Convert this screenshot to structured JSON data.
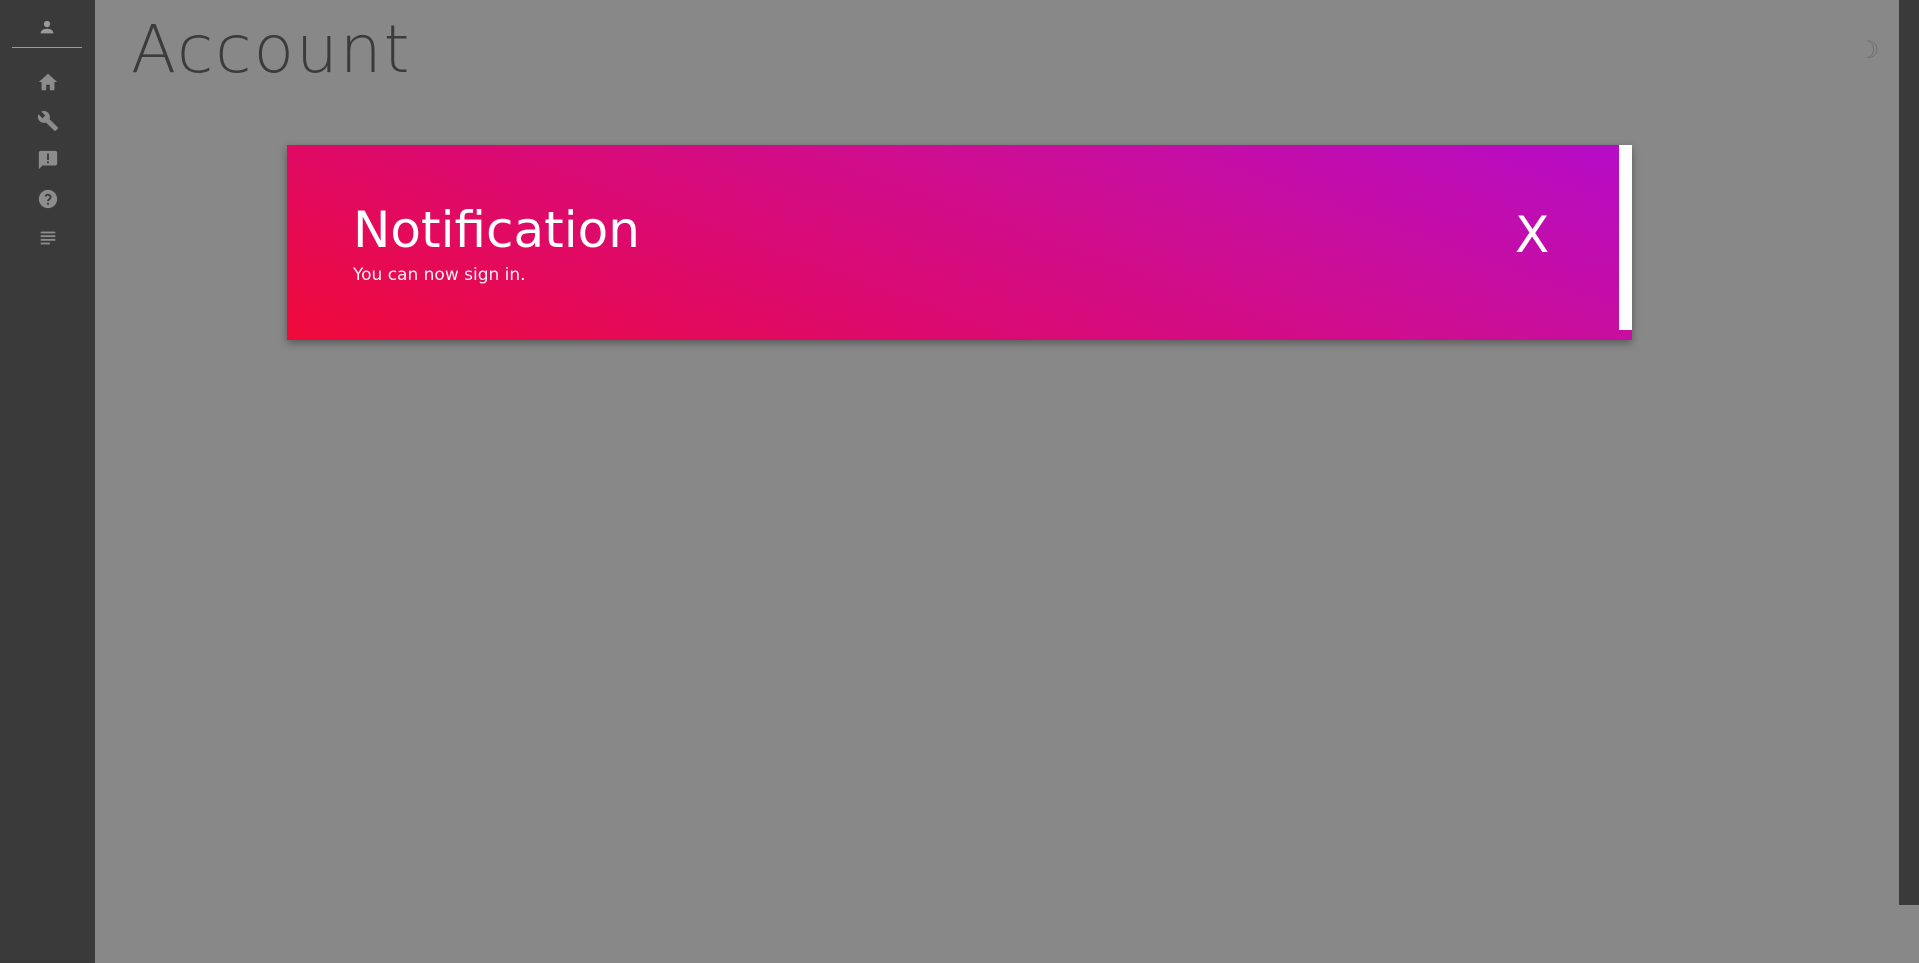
{
  "page": {
    "title": "Account",
    "theme_toggle_icon": "☽",
    "background_color": "#888888",
    "sidebar_color": "#3a3a3a"
  },
  "sidebar": {
    "profile_icon": "person-icon",
    "items": [
      {
        "icon": "home-icon"
      },
      {
        "icon": "wrench-icon"
      },
      {
        "icon": "feedback-icon"
      },
      {
        "icon": "help-icon"
      },
      {
        "icon": "notes-icon"
      }
    ]
  },
  "notification": {
    "title": "Notification",
    "message": "You can now sign in.",
    "close_label": "X",
    "gradient_start": "#f00a3a",
    "gradient_end": "#b50cc9"
  }
}
